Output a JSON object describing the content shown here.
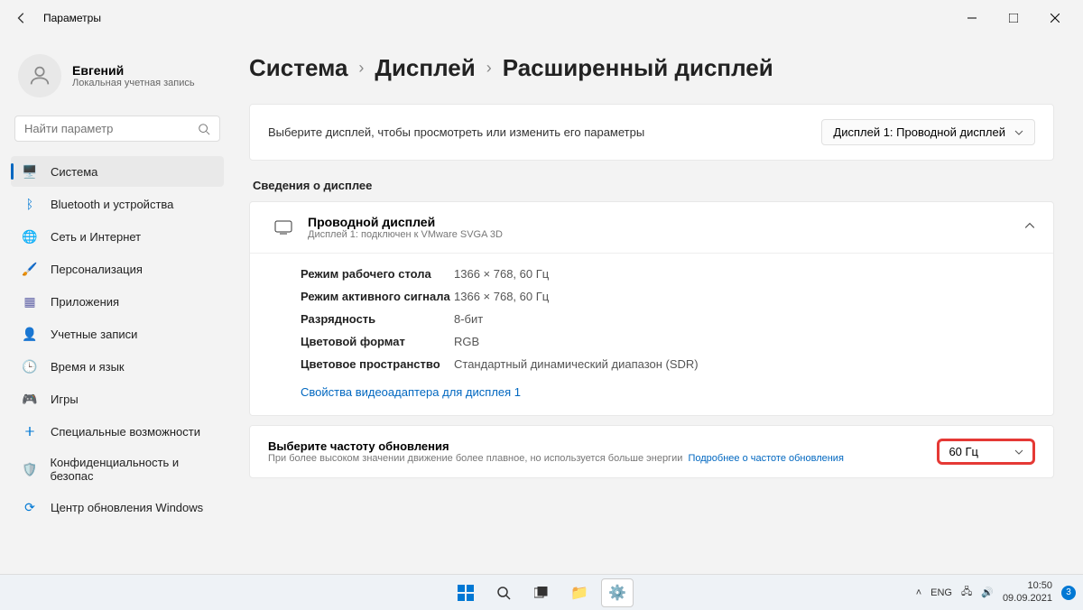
{
  "window": {
    "title": "Параметры"
  },
  "user": {
    "name": "Евгений",
    "subtitle": "Локальная учетная запись"
  },
  "search": {
    "placeholder": "Найти параметр"
  },
  "nav": {
    "items": [
      {
        "label": "Система",
        "icon": "🖥️",
        "color": "#0078d4"
      },
      {
        "label": "Bluetooth и устройства",
        "icon": "ᛒ",
        "color": "#0078d4"
      },
      {
        "label": "Сеть и Интернет",
        "icon": "🌐",
        "color": "#00b0f0"
      },
      {
        "label": "Персонализация",
        "icon": "🖌️",
        "color": "#d83b01"
      },
      {
        "label": "Приложения",
        "icon": "▦",
        "color": "#6264a7"
      },
      {
        "label": "Учетные записи",
        "icon": "👤",
        "color": "#e3008c"
      },
      {
        "label": "Время и язык",
        "icon": "🕒",
        "color": "#107c10"
      },
      {
        "label": "Игры",
        "icon": "🎮",
        "color": "#666"
      },
      {
        "label": "Специальные возможности",
        "icon": "ⵜ",
        "color": "#0078d4"
      },
      {
        "label": "Конфиденциальность и безопас",
        "icon": "🛡️",
        "color": "#0078d4"
      },
      {
        "label": "Центр обновления Windows",
        "icon": "⟳",
        "color": "#0078d4"
      }
    ]
  },
  "breadcrumb": [
    "Система",
    "Дисплей",
    "Расширенный дисплей"
  ],
  "selectDisplay": {
    "text": "Выберите дисплей, чтобы просмотреть или изменить его параметры",
    "dropdown": "Дисплей 1: Проводной дисплей"
  },
  "infoHeading": "Сведения о дисплее",
  "displayInfo": {
    "title": "Проводной дисплей",
    "subtitle": "Дисплей 1: подключен к VMware SVGA 3D"
  },
  "details": [
    {
      "label": "Режим рабочего стола",
      "value": "1366 × 768, 60 Гц"
    },
    {
      "label": "Режим активного сигнала",
      "value": "1366 × 768, 60 Гц"
    },
    {
      "label": "Разрядность",
      "value": "8-бит"
    },
    {
      "label": "Цветовой формат",
      "value": "RGB"
    },
    {
      "label": "Цветовое пространство",
      "value": "Стандартный динамический диапазон (SDR)"
    }
  ],
  "adapterLink": "Свойства видеоадаптера для дисплея 1",
  "refreshRate": {
    "title": "Выберите частоту обновления",
    "subtitle": "При более высоком значении движение более плавное, но используется больше энергии",
    "link": "Подробнее о частоте обновления",
    "value": "60 Гц"
  },
  "taskbar": {
    "lang": "ENG",
    "time": "10:50",
    "date": "09.09.2021",
    "notifCount": "3"
  }
}
